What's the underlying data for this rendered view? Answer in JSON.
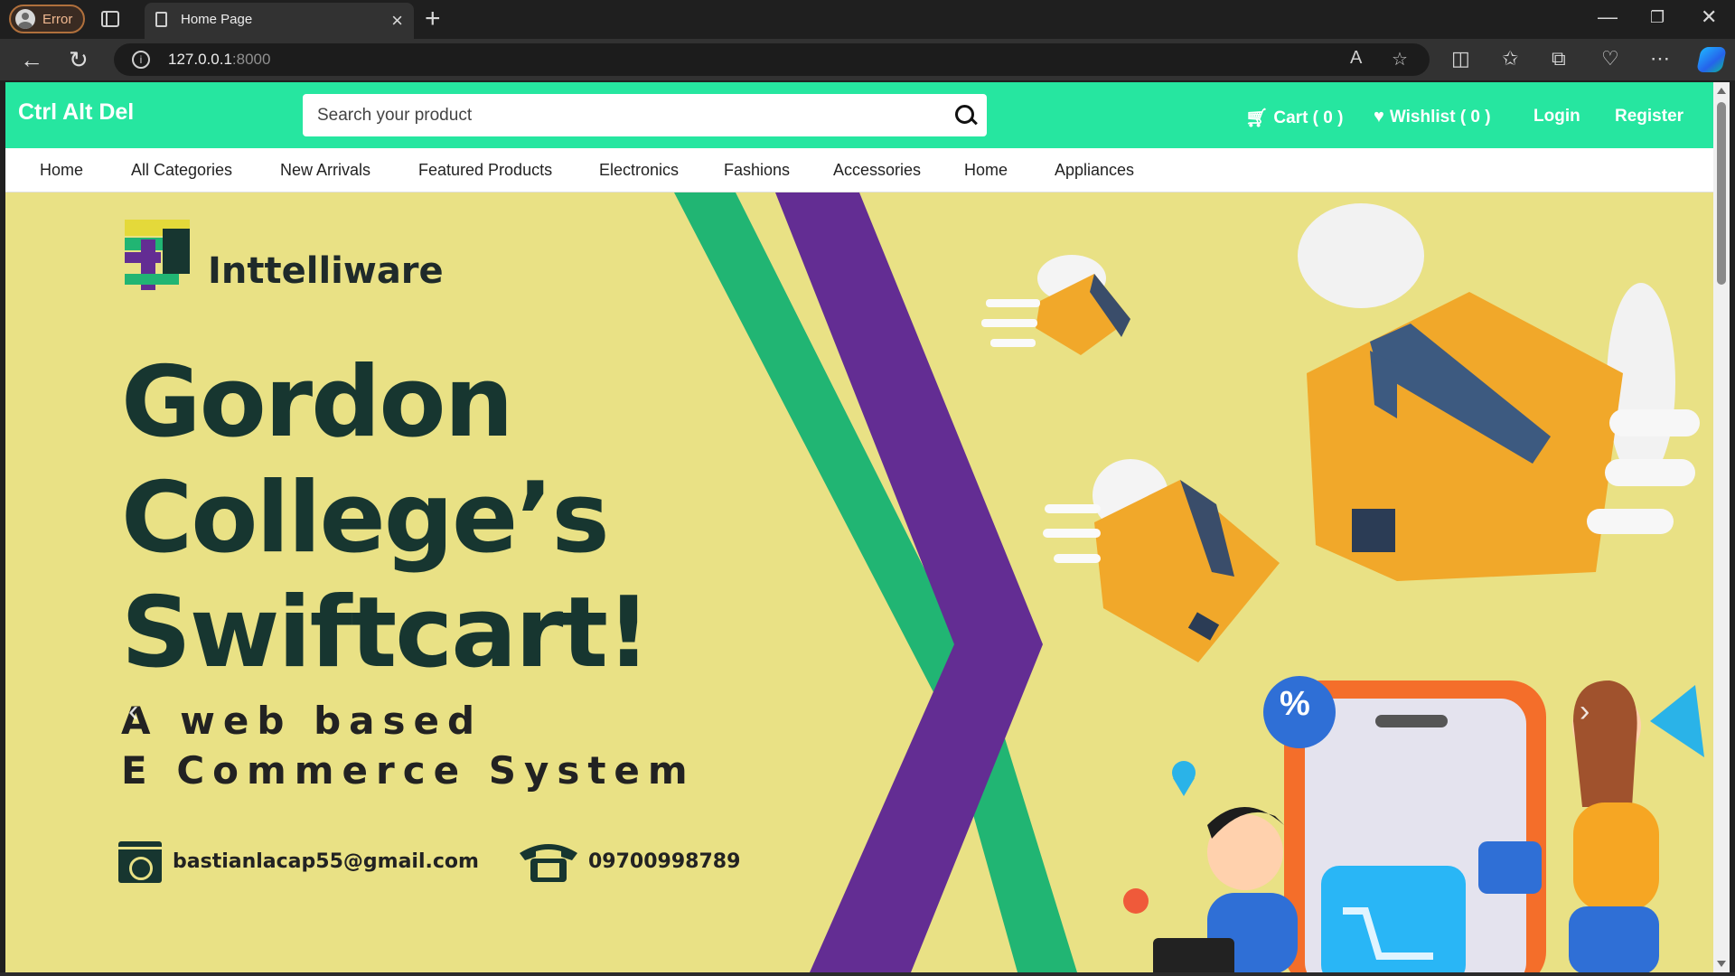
{
  "browser": {
    "profile_label": "Error",
    "tab_title": "Home Page",
    "url_host": "127.0.0.1",
    "url_port": ":8000"
  },
  "site": {
    "brand": "Ctrl Alt Del",
    "search_placeholder": "Search your product",
    "cart_label": "Cart ( 0 )",
    "wishlist_label": "Wishlist ( 0 )",
    "login_label": "Login",
    "register_label": "Register",
    "accent_color": "#26e6a0"
  },
  "nav": {
    "items": [
      "Home",
      "All Categories",
      "New Arrivals",
      "Featured Products",
      "Electronics",
      "Fashions",
      "Accessories",
      "Home",
      "Appliances"
    ]
  },
  "hero": {
    "logo_name": "Inttelliware",
    "headline_lines": [
      "Gordon",
      "College’s",
      "Swiftcart!"
    ],
    "subline_lines": [
      "A web based",
      "E Commerce System"
    ],
    "email": "bastianlacap55@gmail.com",
    "phone": "09700998789",
    "percent_badge": "%",
    "background_color": "#e9e185"
  }
}
